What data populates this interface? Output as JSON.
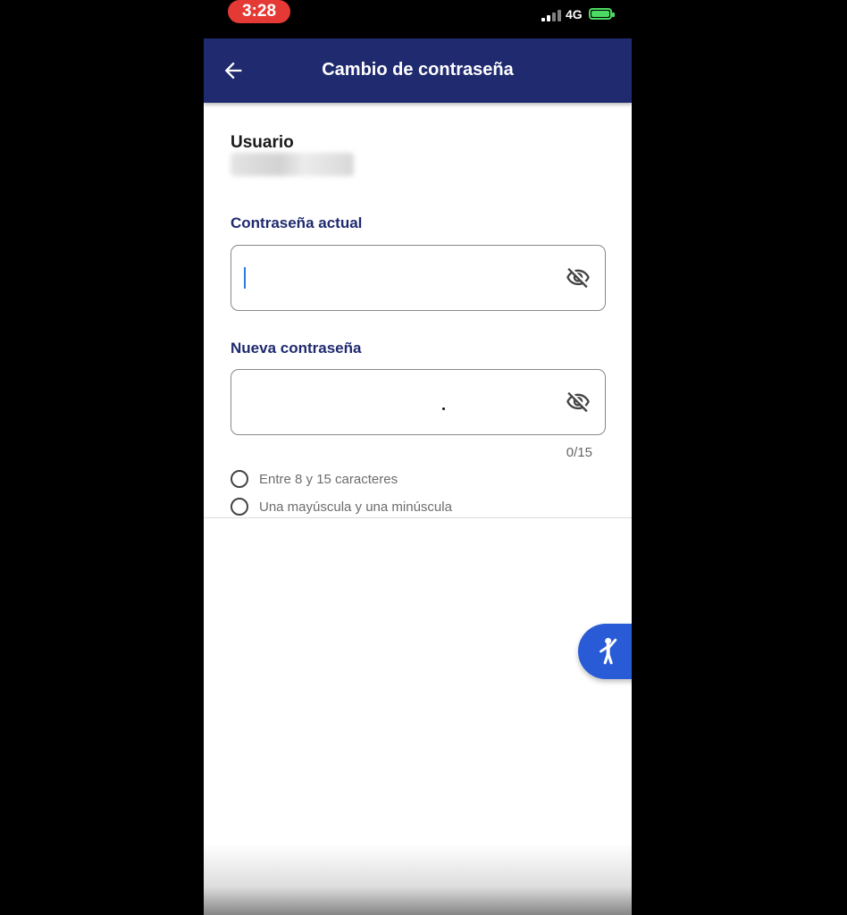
{
  "status_bar": {
    "time": "3:28",
    "network": "4G"
  },
  "app_bar": {
    "title": "Cambio de contraseña"
  },
  "user": {
    "label": "Usuario",
    "value": ""
  },
  "current_password": {
    "label": "Contraseña actual",
    "value": ""
  },
  "new_password": {
    "label": "Nueva contraseña",
    "value": "",
    "counter": "0/15"
  },
  "requirements": [
    {
      "text": "Entre 8 y 15 caracteres",
      "met": false
    },
    {
      "text": "Una mayúscula y una minúscula",
      "met": false
    }
  ],
  "colors": {
    "app_bar": "#1f2a6f",
    "label": "#1f2a6f",
    "fab": "#2a5bd7",
    "time_pill": "#e53935",
    "battery": "#4cd964"
  },
  "icons": {
    "back": "arrow-left-icon",
    "visibility": "eye-off-icon",
    "fab": "accessibility-icon",
    "battery": "battery-charging-icon",
    "signal": "signal-bars-icon"
  }
}
